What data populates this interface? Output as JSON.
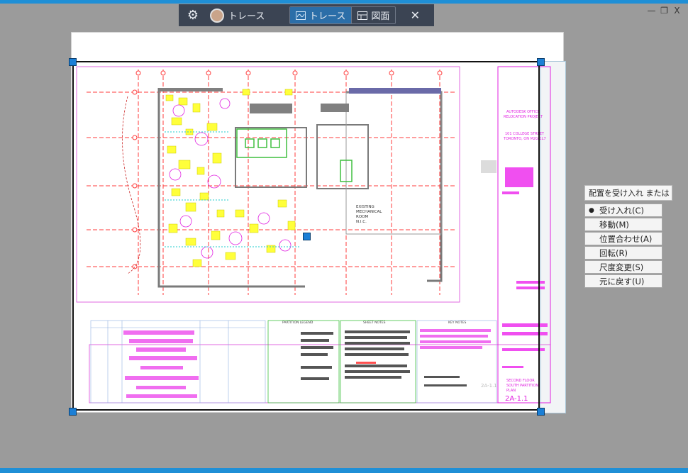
{
  "toolbar": {
    "settings_icon": "gear-icon",
    "title": "トレース",
    "tab_trace": "トレース",
    "tab_drawing": "図面",
    "close": "✕"
  },
  "window_controls": {
    "minimize": "—",
    "restore": "❐",
    "close": "X"
  },
  "drawing_text": {
    "project_line1": "AUTODESK OFFICE",
    "project_line2": "RELOCATION PROJECT",
    "address_line1": "101 COLLEGE STREET",
    "address_line2": "TORONTO, ON M2G 1L7",
    "room_line1": "EXISTING",
    "room_line2": "MECHANICAL",
    "room_line3": "ROOM",
    "room_line4": "N.I.C.",
    "partition_legend": "PARTITION LEGEND",
    "sheet_notes": "SHEET NOTES",
    "key_notes": "KEY NOTES",
    "sheet_title_line1": "SECOND FLOOR",
    "sheet_title_line2": "SOUTH PARTITION",
    "sheet_title_line3": "PLAN",
    "sheet_number": "2A-1.1",
    "plan_ref": "2A-1.1"
  },
  "command_prompt": "配置を受け入れ または",
  "options": [
    {
      "label": "受け入れ(C)",
      "selected": true
    },
    {
      "label": "移動(M)",
      "selected": false
    },
    {
      "label": "位置合わせ(A)",
      "selected": false
    },
    {
      "label": "回転(R)",
      "selected": false
    },
    {
      "label": "尺度変更(S)",
      "selected": false
    },
    {
      "label": "元に戻す(U)",
      "selected": false
    }
  ],
  "colors": {
    "accent": "#1f8fd6",
    "toolbar_bg": "#3b4453",
    "active_tab": "#2b6ea8",
    "magenta": "#e01fe0",
    "red": "#ff3030",
    "yellow": "#ffff3a",
    "green": "#40c040"
  }
}
